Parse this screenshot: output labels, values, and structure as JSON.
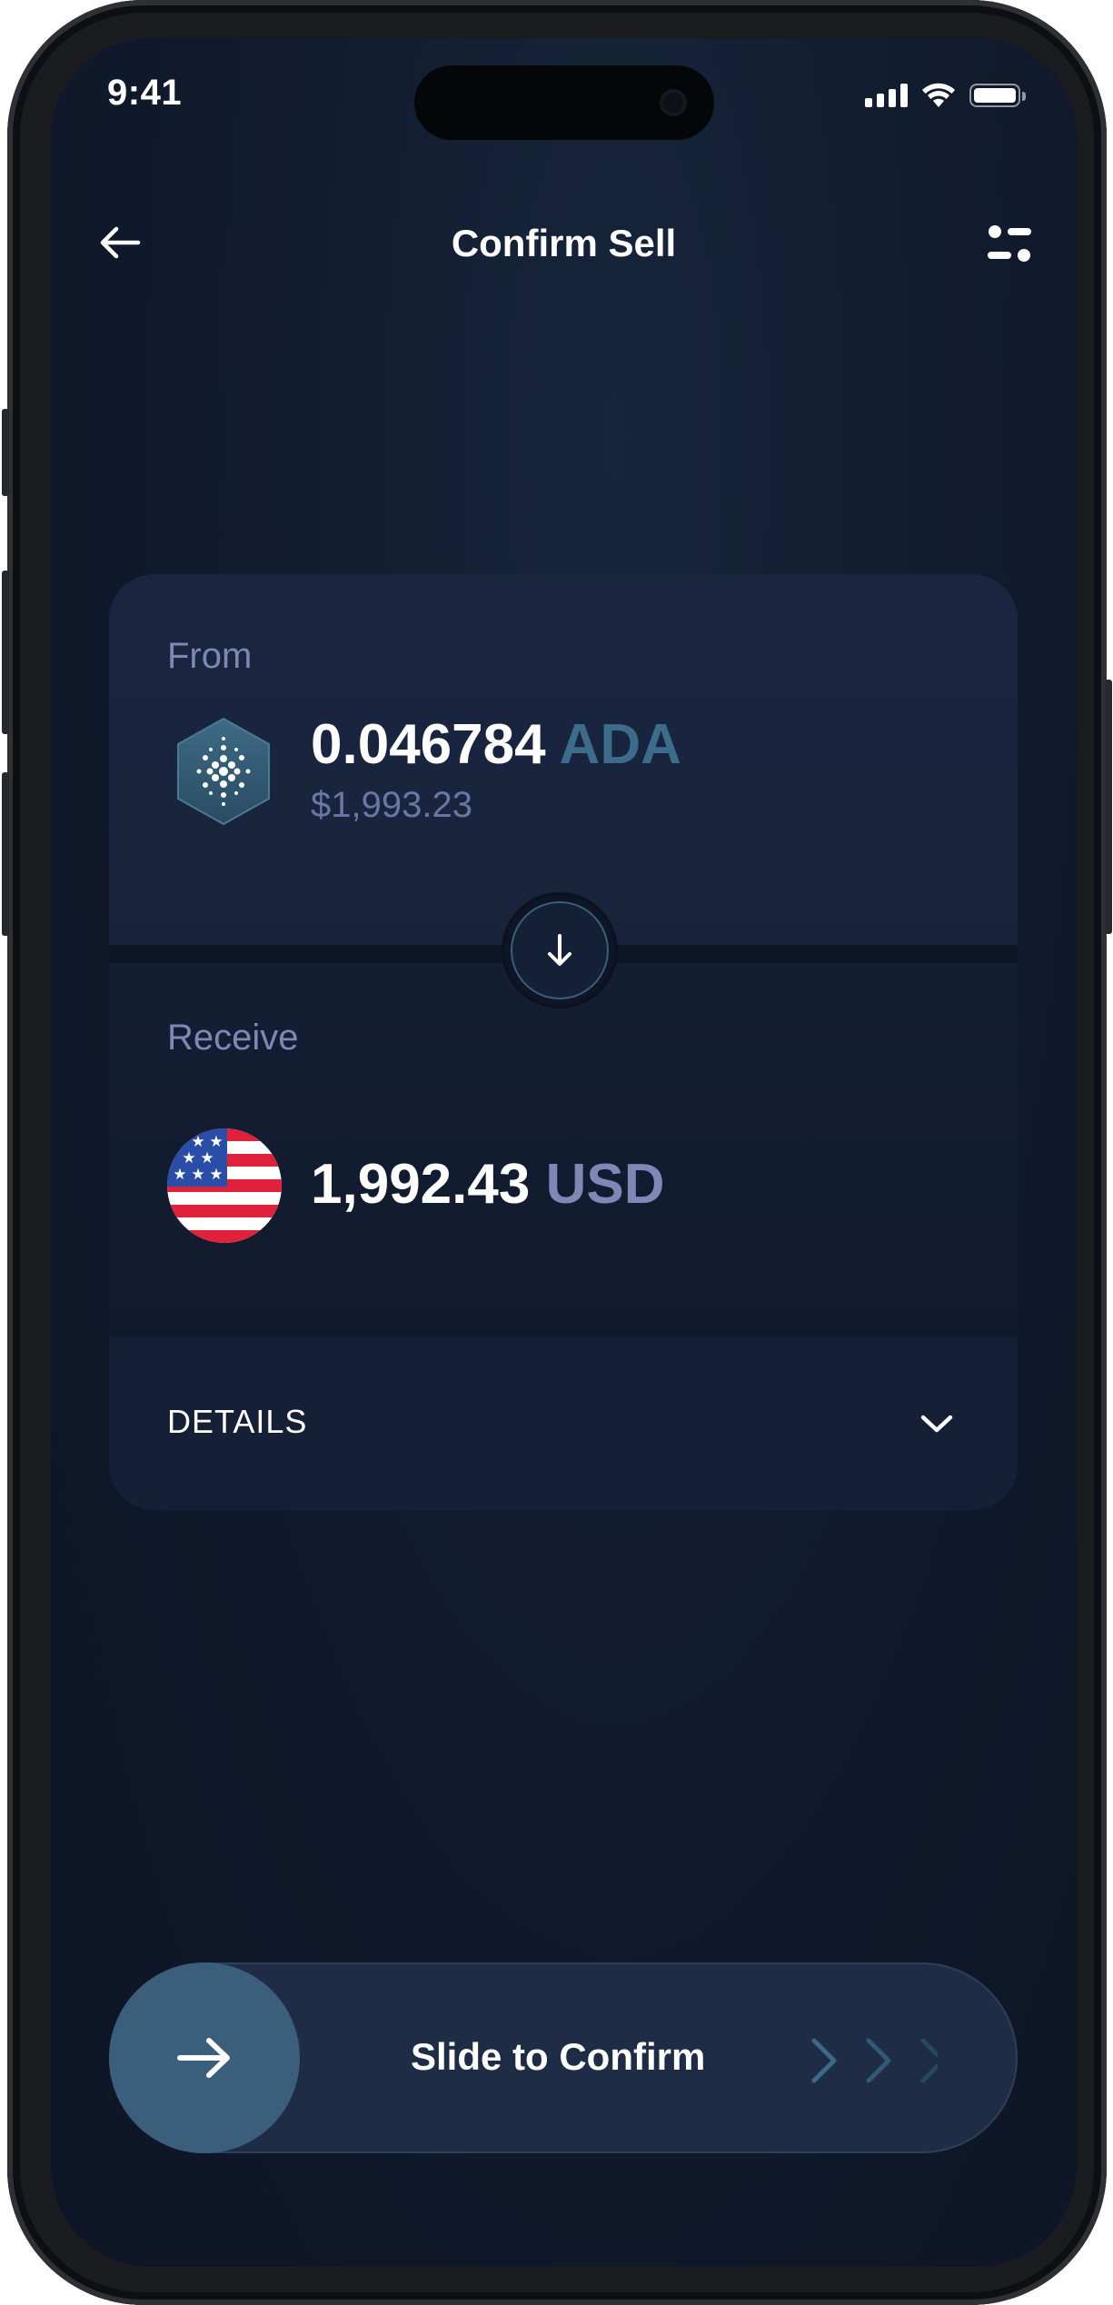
{
  "status_bar": {
    "time": "9:41"
  },
  "header": {
    "title": "Confirm Sell"
  },
  "from": {
    "label": "From",
    "amount": "0.046784",
    "currency": "ADA",
    "fiat_value": "$1,993.23",
    "icon": "cardano-coin-icon"
  },
  "receive": {
    "label": "Receive",
    "amount": "1,992.43",
    "currency": "USD",
    "icon": "us-flag-icon"
  },
  "details": {
    "label": "DETAILS"
  },
  "slider": {
    "label": "Slide to Confirm"
  },
  "colors": {
    "background": "#0f1729",
    "card": "#18233b",
    "accent": "#3b5f7a",
    "muted_text": "#7d88b5"
  }
}
